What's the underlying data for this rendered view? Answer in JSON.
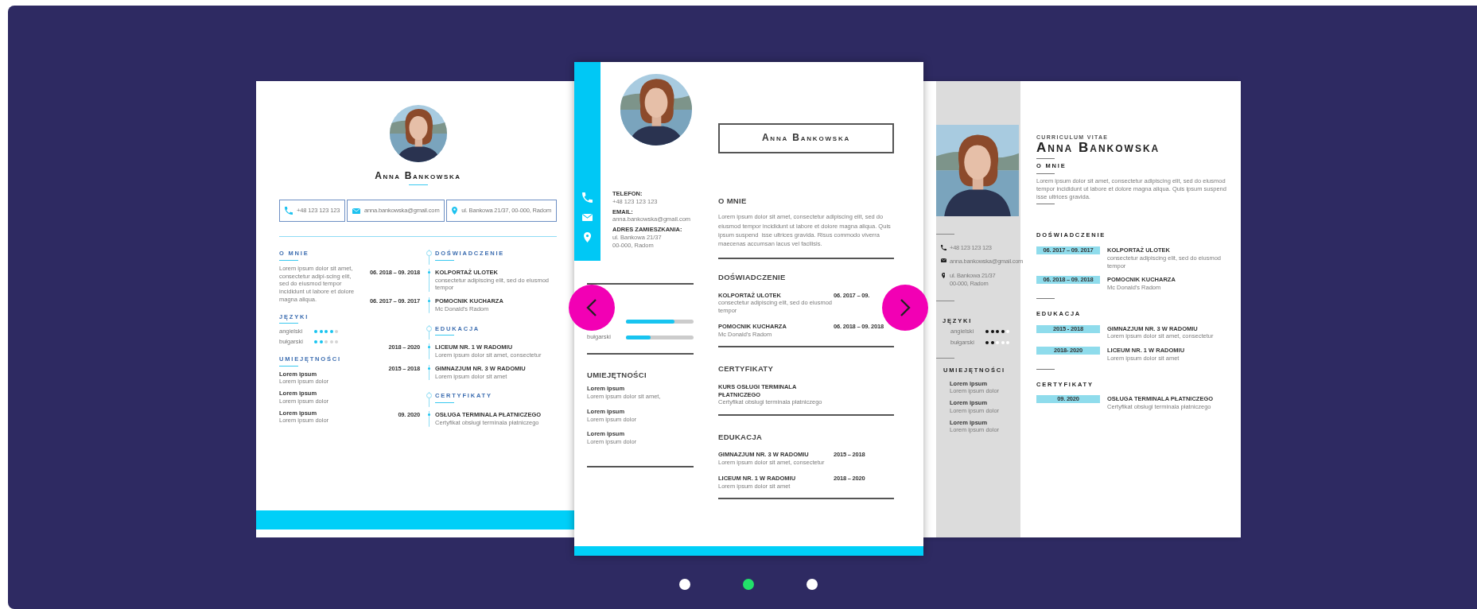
{
  "carousel": {
    "slides": [
      {
        "kind": "centered",
        "name": "Anna Bankowska",
        "contacts": [
          {
            "kind": "phone",
            "lines": [
              "+48 123 123 123"
            ]
          },
          {
            "kind": "email",
            "lines": [
              "anna.bankowska@gmail.com"
            ]
          },
          {
            "kind": "address",
            "lines": [
              "ul. Bankowa 21/37, 00-000, Radom"
            ]
          }
        ],
        "about": {
          "title": "O MNIE",
          "text": "Lorem ipsum dolor sit amet, consectetur adipi-scing elit, sed do eiusmod tempor incididunt ut labore et dolore magna aliqua."
        },
        "languages": {
          "title": "JĘZYKI",
          "items": [
            {
              "name": "angielski",
              "stars": 4
            },
            {
              "name": "bułgarski",
              "stars": 2
            }
          ]
        },
        "skills": {
          "title": "UMIEJĘTNOŚCI",
          "items": [
            {
              "name": "Lorem ipsum",
              "detail": "Lorem ipsum dolor"
            },
            {
              "name": "Lorem ipsum",
              "detail": "Lorem ipsum dolor"
            },
            {
              "name": "Lorem ipsum",
              "detail": "Lorem ipsum dolor"
            }
          ]
        },
        "sections": [
          {
            "title": "DOŚWIADCZENIE",
            "entries": [
              {
                "date": "06. 2018 – 09. 2018",
                "title": "KOLPORTAŻ ULOTEK",
                "detail": "consectetur adipiscing elit, sed do eiusmod tempor"
              },
              {
                "date": "06. 2017 – 09. 2017",
                "title": "POMOCNIK KUCHARZA",
                "detail": "Mc Donald's Radom"
              }
            ]
          },
          {
            "title": "EDUKACJA",
            "entries": [
              {
                "date": "2018 – 2020",
                "title": "LICEUM NR. 1 W RADOMIU",
                "detail": "Lorem ipsum dolor sit amet, consectetur"
              },
              {
                "date": "2015 – 2018",
                "title": "GIMNAZJUM NR. 3 W RADOMIU",
                "detail": "Lorem ipsum dolor sit amet"
              }
            ]
          },
          {
            "title": "CERTYFIKATY",
            "entries": [
              {
                "date": "09. 2020",
                "title": "OSŁUGA TERMINALA PŁATNICZEGO",
                "detail": "Certyfikat obsługi terminala płatniczego"
              }
            ]
          }
        ]
      },
      {
        "kind": "strip",
        "name": "Anna Bankowska",
        "contacts": [
          {
            "kind": "phone",
            "label": "TELEFON:",
            "lines": [
              "+48 123 123 123"
            ]
          },
          {
            "kind": "email",
            "label": "EMAIL:",
            "lines": [
              "anna.bankowska@gmail.com"
            ]
          },
          {
            "kind": "address",
            "label": "ADRES ZAMIESZKANIA:",
            "lines": [
              "ul. Bankowa 21/37",
              "00-000, Radom"
            ]
          }
        ],
        "about": {
          "title": "O MNIE",
          "text": "Lorem ipsum dolor sit amet, consectetur adipiscing elit, sed do eiusmod tempor incididunt ut labore et dolore magna aliqua. Quis ipsum suspend  isse ultrices gravida. Risus commodo viverra maecenas accumsan lacus vel facilisis."
        },
        "languages": {
          "items": [
            {
              "level": 0.72
            },
            {
              "name": "bułgarski",
              "level": 0.36
            }
          ]
        },
        "skills": {
          "title": "UMIEJĘTNOŚCI",
          "items": [
            {
              "name": "Lorem ipsum",
              "detail": "Lorem ipsum dolor sit amet,"
            },
            {
              "name": "Lorem ipsum",
              "detail": "Lorem ipsum dolor"
            },
            {
              "name": "Lorem ipsum",
              "detail": "Lorem ipsum dolor"
            }
          ]
        },
        "sections": [
          {
            "title": "DOŚWIADCZENIE",
            "entries": [
              {
                "date": "06. 2017 – 09.",
                "title": "KOLPORTAŻ ULOTEK",
                "detail": "consectetur adipiscing elit, sed do eiusmod tempor"
              },
              {
                "date": "06. 2018 – 09. 2018",
                "title": "POMOCNIK KUCHARZA",
                "detail": "Mc Donald's Radom"
              }
            ]
          },
          {
            "title": "CERTYFIKATY",
            "entries": [
              {
                "title": "KURS OSŁUGI TERMINALA PŁATNICZEGO",
                "detail": "Certyfikat obsługi terminala płatniczego"
              }
            ]
          },
          {
            "title": "EDUKACJA",
            "entries": [
              {
                "date": "2015 – 2018",
                "title": "GIMNAZJUM NR. 3 W RADOMIU",
                "detail": "Lorem ipsum dolor sit amet, consectetur"
              },
              {
                "date": "2018 – 2020",
                "title": "LICEUM NR. 1 W RADOMIU",
                "detail": "Lorem ipsum dolor sit amet"
              }
            ]
          }
        ]
      },
      {
        "kind": "sidebar",
        "subtitle": "CURRICULUM VITAE",
        "name": "Anna Bankowska",
        "contacts": [
          {
            "kind": "phone",
            "lines": [
              "+48 123 123 123"
            ]
          },
          {
            "kind": "email",
            "lines": [
              "anna.bankowska@gmail.com"
            ]
          },
          {
            "kind": "address",
            "lines": [
              "ul. Bankowa 21/37",
              "00-000, Radom"
            ]
          }
        ],
        "about": {
          "title": "O MNIE",
          "text": "Lorem ipsum dolor sit amet, consectetur adipiscing elit, sed do eiusmod tempor incididunt ut labore et dolore magna aliqua. Quis ipsum suspend  isse ultrices gravida."
        },
        "languages": {
          "title": "JĘZYKI",
          "items": [
            {
              "name": "angielski",
              "stars": 4
            },
            {
              "name": "bułgarski",
              "stars": 2
            }
          ]
        },
        "skills": {
          "title": "UMIEJĘTNOŚCI",
          "items": [
            {
              "name": "Lorem ipsum",
              "detail": "Lorem ipsum dolor"
            },
            {
              "name": "Lorem ipsum",
              "detail": "Lorem ipsum dolor"
            },
            {
              "name": "Lorem ipsum",
              "detail": "Lorem ipsum dolor"
            }
          ]
        },
        "sections": [
          {
            "title": "DOŚWIADCZENIE",
            "entries": [
              {
                "date": "06. 2017 – 09. 2017",
                "title": "KOLPORTAŻ ULOTEK",
                "detail": "consectetur adipiscing elit, sed do eiusmod tempor"
              },
              {
                "date": "06. 2018 – 09. 2018",
                "title": "POMOCNIK KUCHARZA",
                "detail": "Mc Donald's Radom"
              }
            ]
          },
          {
            "title": "EDUKACJA",
            "entries": [
              {
                "date": "2015 - 2018",
                "title": "GIMNAZJUM NR. 3 W RADOMIU",
                "detail": "Lorem ipsum dolor sit amet, consectetur"
              },
              {
                "date": "2018- 2020",
                "title": "LICEUM NR. 1 W RADOMIU",
                "detail": "Lorem ipsum dolor sit amet"
              }
            ]
          },
          {
            "title": "CERTYFIKATY",
            "entries": [
              {
                "date": "09. 2020",
                "title": "OSŁUGA TERMINALA PŁATNICZEGO",
                "detail": "Certyfikat obsługi terminala płatniczego"
              }
            ]
          }
        ]
      }
    ],
    "dots": [
      {
        "selected": false
      },
      {
        "selected": true
      },
      {
        "selected": false
      }
    ]
  }
}
